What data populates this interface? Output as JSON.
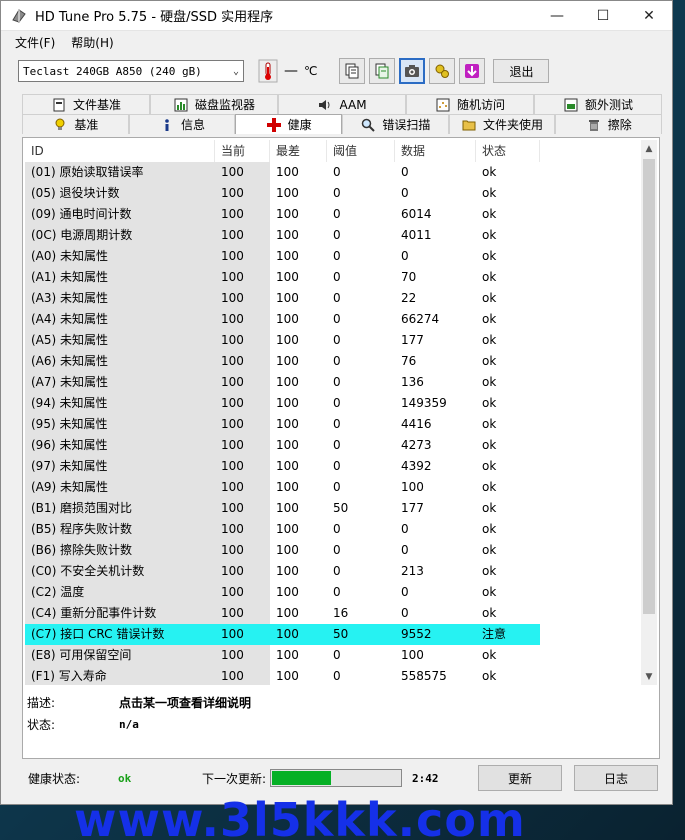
{
  "window": {
    "title": "HD Tune Pro 5.75 - 硬盘/SSD 实用程序"
  },
  "menu": {
    "file": "文件(F)",
    "help": "帮助(H)"
  },
  "toolbar": {
    "drive": "Teclast 240GB A850 (240 gB)",
    "temperature": "—",
    "temp_unit": "℃",
    "exit": "退出"
  },
  "tabs_row1": [
    "文件基准",
    "磁盘监视器",
    "AAM",
    "随机访问",
    "额外测试"
  ],
  "tabs_row2": [
    "基准",
    "信息",
    "健康",
    "错误扫描",
    "文件夹使用",
    "擦除"
  ],
  "table": {
    "headers": [
      "ID",
      "当前",
      "最差",
      "阈值",
      "数据",
      "状态"
    ],
    "rows": [
      [
        "(01) 原始读取错误率",
        "100",
        "100",
        "0",
        "0",
        "ok"
      ],
      [
        "(05) 退役块计数",
        "100",
        "100",
        "0",
        "0",
        "ok"
      ],
      [
        "(09) 通电时间计数",
        "100",
        "100",
        "0",
        "6014",
        "ok"
      ],
      [
        "(0C) 电源周期计数",
        "100",
        "100",
        "0",
        "4011",
        "ok"
      ],
      [
        "(A0) 未知属性",
        "100",
        "100",
        "0",
        "0",
        "ok"
      ],
      [
        "(A1) 未知属性",
        "100",
        "100",
        "0",
        "70",
        "ok"
      ],
      [
        "(A3) 未知属性",
        "100",
        "100",
        "0",
        "22",
        "ok"
      ],
      [
        "(A4) 未知属性",
        "100",
        "100",
        "0",
        "66274",
        "ok"
      ],
      [
        "(A5) 未知属性",
        "100",
        "100",
        "0",
        "177",
        "ok"
      ],
      [
        "(A6) 未知属性",
        "100",
        "100",
        "0",
        "76",
        "ok"
      ],
      [
        "(A7) 未知属性",
        "100",
        "100",
        "0",
        "136",
        "ok"
      ],
      [
        "(94) 未知属性",
        "100",
        "100",
        "0",
        "149359",
        "ok"
      ],
      [
        "(95) 未知属性",
        "100",
        "100",
        "0",
        "4416",
        "ok"
      ],
      [
        "(96) 未知属性",
        "100",
        "100",
        "0",
        "4273",
        "ok"
      ],
      [
        "(97) 未知属性",
        "100",
        "100",
        "0",
        "4392",
        "ok"
      ],
      [
        "(A9) 未知属性",
        "100",
        "100",
        "0",
        "100",
        "ok"
      ],
      [
        "(B1) 磨损范围对比",
        "100",
        "100",
        "50",
        "177",
        "ok"
      ],
      [
        "(B5) 程序失败计数",
        "100",
        "100",
        "0",
        "0",
        "ok"
      ],
      [
        "(B6) 擦除失败计数",
        "100",
        "100",
        "0",
        "0",
        "ok"
      ],
      [
        "(C0) 不安全关机计数",
        "100",
        "100",
        "0",
        "213",
        "ok"
      ],
      [
        "(C2) 温度",
        "100",
        "100",
        "0",
        "0",
        "ok"
      ],
      [
        "(C4) 重新分配事件计数",
        "100",
        "100",
        "16",
        "0",
        "ok"
      ],
      [
        "(C7) 接口 CRC 错误计数",
        "100",
        "100",
        "50",
        "9552",
        "注意"
      ],
      [
        "(E8) 可用保留空间",
        "100",
        "100",
        "0",
        "100",
        "ok"
      ],
      [
        "(F1) 写入寿命",
        "100",
        "100",
        "0",
        "558575",
        "ok"
      ]
    ],
    "highlight_row": 22,
    "highlight_color": "#26f2f2"
  },
  "details": {
    "desc_label": "描述:",
    "desc_value": "点击某一项查看详细说明",
    "status_label": "状态:",
    "status_value": "n/a"
  },
  "footer": {
    "health_label": "健康状态:",
    "health_value": "ok",
    "next_update_label": "下一次更新:",
    "progress": 0.45,
    "time": "2:42",
    "refresh": "更新",
    "log": "日志"
  },
  "watermark": "www.3l5kkk.com",
  "colors": {
    "progress": "#06b025",
    "watermark": "#1530e8",
    "health_ok": "#1aa01a"
  }
}
